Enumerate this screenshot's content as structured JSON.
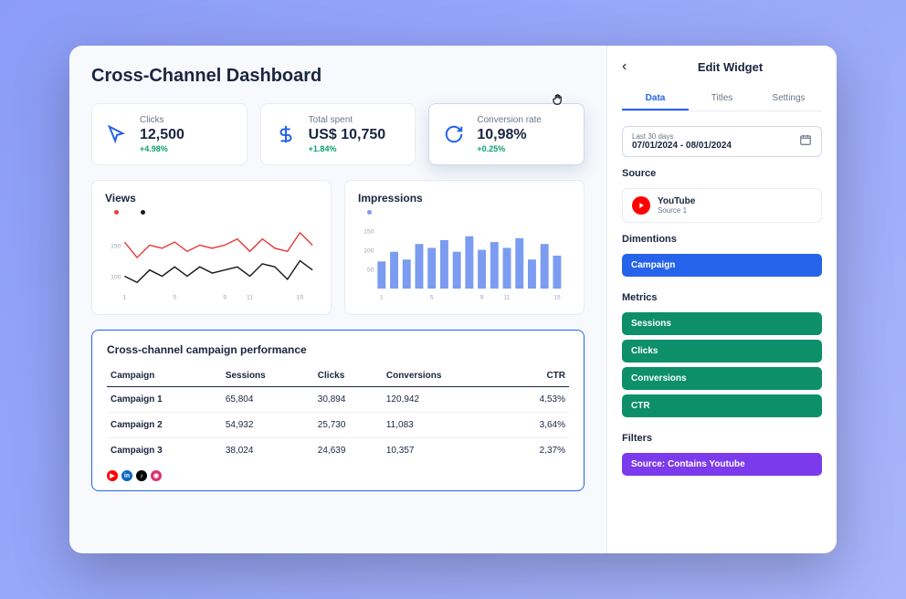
{
  "title": "Cross-Channel Dashboard",
  "kpi": [
    {
      "label": "Clicks",
      "value": "12,500",
      "delta": "+4.98%",
      "icon": "cursor"
    },
    {
      "label": "Total spent",
      "value": "US$ 10,750",
      "delta": "+1.84%",
      "icon": "dollar"
    },
    {
      "label": "Conversion rate",
      "value": "10,98%",
      "delta": "+0.25%",
      "icon": "refresh"
    }
  ],
  "views_title": "Views",
  "impressions_title": "Impressions",
  "chart_data": [
    {
      "type": "line",
      "title": "Views",
      "x": [
        1,
        2,
        3,
        4,
        5,
        6,
        7,
        8,
        9,
        10,
        11,
        12,
        13,
        14,
        15,
        16
      ],
      "xticks": [
        1,
        5,
        9,
        11,
        15
      ],
      "yticks": [
        100,
        150
      ],
      "series": [
        {
          "name": "series-a",
          "color": "#e53e3e",
          "values": [
            155,
            130,
            150,
            145,
            155,
            140,
            150,
            145,
            150,
            160,
            140,
            160,
            145,
            140,
            170,
            150
          ]
        },
        {
          "name": "series-b",
          "color": "#1a1a1a",
          "values": [
            100,
            90,
            110,
            100,
            115,
            100,
            115,
            105,
            110,
            115,
            100,
            120,
            115,
            95,
            125,
            110
          ]
        }
      ]
    },
    {
      "type": "bar",
      "title": "Impressions",
      "x": [
        1,
        2,
        3,
        4,
        5,
        6,
        7,
        8,
        9,
        10,
        11,
        12,
        13,
        14,
        15
      ],
      "xticks": [
        1,
        5,
        9,
        11,
        15
      ],
      "yticks": [
        50,
        100,
        150
      ],
      "values": [
        70,
        95,
        75,
        115,
        105,
        125,
        95,
        135,
        100,
        120,
        105,
        130,
        75,
        115,
        85
      ],
      "color": "#7b9cf0"
    }
  ],
  "table": {
    "title": "Cross-channel campaign performance",
    "columns": [
      "Campaign",
      "Sessions",
      "Clicks",
      "Conversions",
      "CTR"
    ],
    "rows": [
      [
        "Campaign 1",
        "65,804",
        "30,894",
        "120,942",
        "4,53%"
      ],
      [
        "Campaign 2",
        "54,932",
        "25,730",
        "11,083",
        "3,64%"
      ],
      [
        "Campaign 3",
        "38,024",
        "24,639",
        "10,357",
        "2,37%"
      ]
    ]
  },
  "social_icons": [
    "youtube",
    "linkedin",
    "tiktok",
    "instagram"
  ],
  "sidebar": {
    "title": "Edit Widget",
    "tabs": [
      "Data",
      "Titles",
      "Settings"
    ],
    "date": {
      "label": "Last 30 days",
      "range": "07/01/2024 - 08/01/2024"
    },
    "source": {
      "heading": "Source",
      "name": "YouTube",
      "sub": "Source 1"
    },
    "dimensions": {
      "heading": "Dimentions",
      "items": [
        "Campaign"
      ]
    },
    "metrics": {
      "heading": "Metrics",
      "items": [
        "Sessions",
        "Clicks",
        "Conversions",
        "CTR"
      ]
    },
    "filters": {
      "heading": "Filters",
      "items": [
        "Source: Contains Youtube"
      ]
    }
  }
}
